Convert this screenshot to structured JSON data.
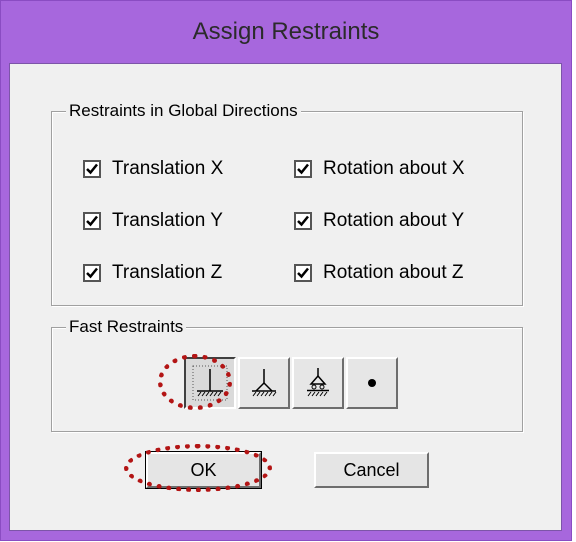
{
  "window": {
    "title": "Assign Restraints"
  },
  "restraints_group": {
    "title": "Restraints in Global Directions",
    "items": [
      {
        "label": "Translation X",
        "checked": true
      },
      {
        "label": "Rotation about X",
        "checked": true
      },
      {
        "label": "Translation Y",
        "checked": true
      },
      {
        "label": "Rotation about Y",
        "checked": true
      },
      {
        "label": "Translation Z",
        "checked": true
      },
      {
        "label": "Rotation about Z",
        "checked": true
      }
    ]
  },
  "fast_group": {
    "title": "Fast Restraints",
    "buttons": [
      {
        "icon": "fixed-support-icon",
        "pressed": true
      },
      {
        "icon": "pinned-support-icon",
        "pressed": false
      },
      {
        "icon": "roller-support-icon",
        "pressed": false
      },
      {
        "icon": "free-joint-icon",
        "pressed": false
      }
    ]
  },
  "actions": {
    "ok_label": "OK",
    "cancel_label": "Cancel"
  },
  "annotation": {
    "color": "#b31515"
  }
}
